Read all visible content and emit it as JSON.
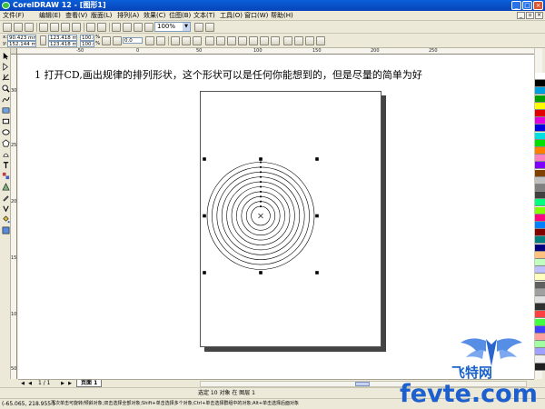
{
  "window": {
    "title": "CorelDRAW 12 - [图形1]"
  },
  "menu": {
    "items": [
      "文件(F)",
      "编辑(E)",
      "查看(V)",
      "版面(L)",
      "排列(A)",
      "效果(C)",
      "位图(B)",
      "文本(T)",
      "工具(O)",
      "窗口(W)",
      "帮助(H)"
    ]
  },
  "toolbar": {
    "zoom_value": "100%"
  },
  "property_bar": {
    "x_label": "x:",
    "x_value": "90.423 mm",
    "y_label": "y:",
    "y_value": "152.144 mm",
    "width_value": "123.418 mm",
    "height_value": "123.418 mm",
    "scale_x": "100.0",
    "scale_y": "100.0",
    "scale_unit": "%",
    "rotation_value": "0.0"
  },
  "rulers": {
    "horizontal_ticks": [
      "-50",
      "0",
      "50",
      "100",
      "150",
      "200",
      "250"
    ],
    "vertical_ticks": [
      "300",
      "250",
      "200",
      "150",
      "100",
      "50"
    ]
  },
  "canvas": {
    "caption": "1 打开CD,画出规律的排列形状，这个形状可以是任何你能想到的，但是尽量的简单为好",
    "cd_circle_count": 10
  },
  "page_navigator": {
    "page_count": "1 / 1",
    "current_tab": "页面 1"
  },
  "status": {
    "selection_text": "选定 10 对象 在 图层 1",
    "coordinates": "(-65.065, 218.955 )",
    "hint": "再次单击可旋转/倾斜对象;双击选择全部对象;Shift+单击选择多个对象;Ctrl+单击选择群组中的对象;Alt+单击选择后面对象"
  },
  "palette": {
    "colors": [
      "#ffffff",
      "#000000",
      "#00a0e0",
      "#00a000",
      "#ffff00",
      "#e00000",
      "#e000e0",
      "#0000e0",
      "#00e0e0",
      "#00e000",
      "#ff8000",
      "#ff80c0",
      "#8000ff",
      "#804000",
      "#c0c0c0",
      "#808080",
      "#404040",
      "#00ff80",
      "#80ff00",
      "#ff0080",
      "#0080ff",
      "#800000",
      "#008080",
      "#000080",
      "#ffc080",
      "#c0ffc0",
      "#c0c0ff",
      "#ffffc0",
      "#606060",
      "#a0a0a0",
      "#e0e0e0",
      "#303030",
      "#ff4040",
      "#40ff40",
      "#4040ff",
      "#ffa0a0",
      "#a0ffa0",
      "#a0a0ff",
      "#f0f0f0",
      "#202020"
    ]
  },
  "watermark": {
    "site_cn": "飞特网",
    "site_en": "fevte.com"
  }
}
